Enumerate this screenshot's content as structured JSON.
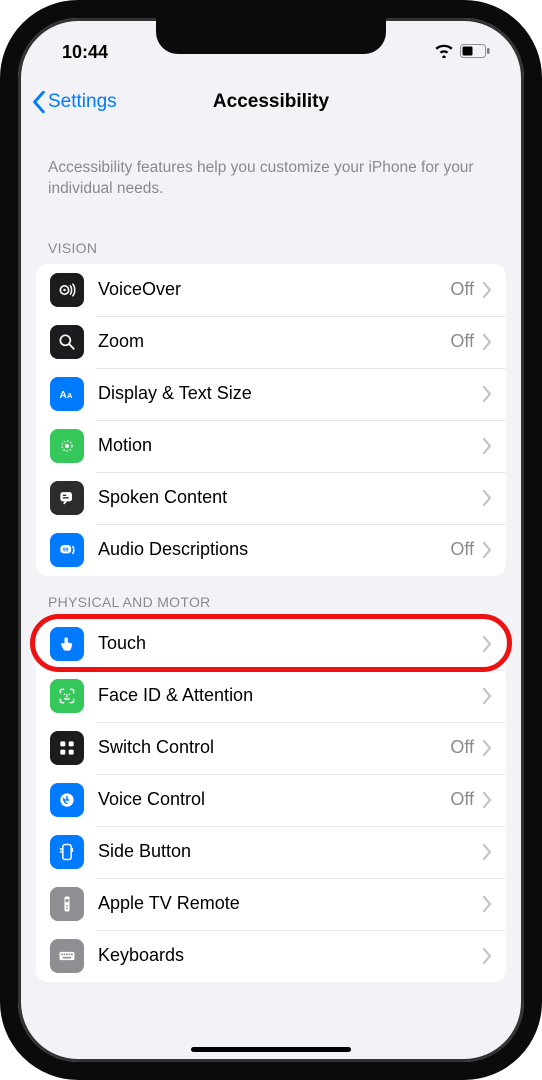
{
  "status": {
    "time": "10:44"
  },
  "nav": {
    "back": "Settings",
    "title": "Accessibility"
  },
  "intro": "Accessibility features help you customize your iPhone for your individual needs.",
  "sections": {
    "vision": {
      "header": "VISION",
      "rows": {
        "voiceover": {
          "label": "VoiceOver",
          "detail": "Off"
        },
        "zoom": {
          "label": "Zoom",
          "detail": "Off"
        },
        "display": {
          "label": "Display & Text Size"
        },
        "motion": {
          "label": "Motion"
        },
        "spoken": {
          "label": "Spoken Content"
        },
        "audiodesc": {
          "label": "Audio Descriptions",
          "detail": "Off"
        }
      }
    },
    "physical": {
      "header": "PHYSICAL AND MOTOR",
      "rows": {
        "touch": {
          "label": "Touch"
        },
        "faceid": {
          "label": "Face ID & Attention"
        },
        "switch": {
          "label": "Switch Control",
          "detail": "Off"
        },
        "voice": {
          "label": "Voice Control",
          "detail": "Off"
        },
        "sidebtn": {
          "label": "Side Button"
        },
        "tvremote": {
          "label": "Apple TV Remote"
        },
        "keyboards": {
          "label": "Keyboards"
        }
      }
    }
  },
  "annotation": {
    "highlighted_row": "touch"
  }
}
